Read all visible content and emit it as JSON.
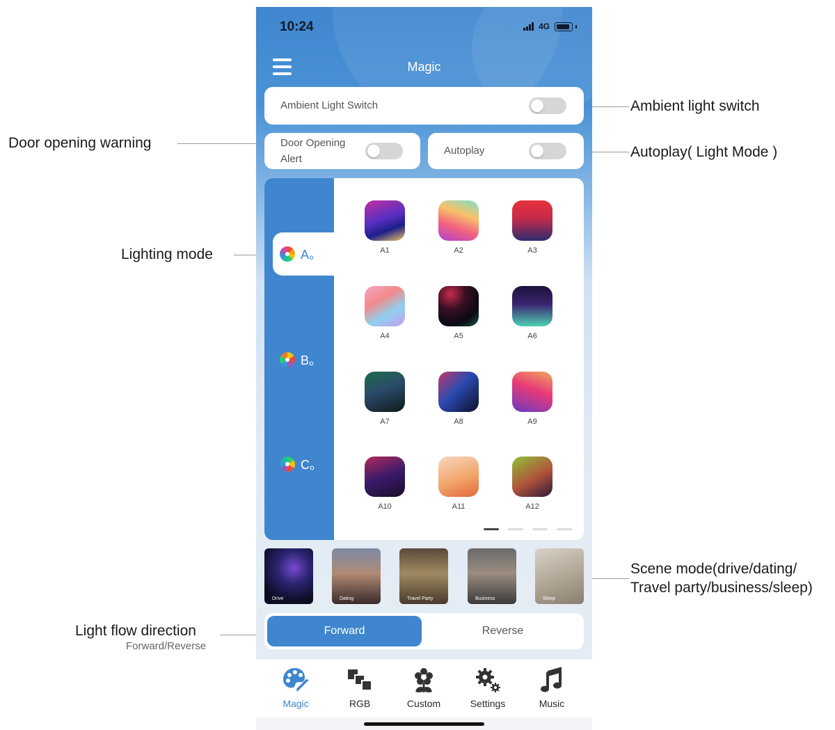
{
  "status_bar": {
    "time": "10:24",
    "network": "4G"
  },
  "header": {
    "title": "Magic"
  },
  "switches": {
    "ambient_label": "Ambient Light Switch",
    "door_label_line1": "Door Opening",
    "door_label_line2": "Alert",
    "autoplay_label": "Autoplay"
  },
  "modes": {
    "tabs": [
      {
        "label": "A。",
        "active": true
      },
      {
        "label": "B。",
        "active": false
      },
      {
        "label": "C。",
        "active": false
      }
    ],
    "items": [
      "A1",
      "A2",
      "A3",
      "A4",
      "A5",
      "A6",
      "A7",
      "A8",
      "A9",
      "A10",
      "A11",
      "A12"
    ],
    "page_count": 4,
    "current_page": 1
  },
  "scenes": [
    "Drive",
    "Dating",
    "Travel Party",
    "Business",
    "Sleep"
  ],
  "direction": {
    "forward": "Forward",
    "reverse": "Reverse",
    "selected": "Forward"
  },
  "nav": {
    "items": [
      {
        "label": "Magic",
        "icon": "palette-icon"
      },
      {
        "label": "RGB",
        "icon": "rgb-squares-icon"
      },
      {
        "label": "Custom",
        "icon": "flower-icon"
      },
      {
        "label": "Settings",
        "icon": "gear-icon"
      },
      {
        "label": "Music",
        "icon": "music-note-icon"
      }
    ],
    "active": "Magic"
  },
  "annotations": {
    "ambient": "Ambient light switch",
    "door": "Door opening warning",
    "autoplay": "Autoplay( Light Mode )",
    "lighting": "Lighting mode",
    "scene_line1": "Scene mode(drive/dating/",
    "scene_line2": "Travel party/business/sleep)",
    "flow": "Light flow direction",
    "flow_sub": "Forward/Reverse"
  },
  "colors": {
    "accent": "#3f86cf",
    "toggle_off": "#d6d6d6"
  }
}
